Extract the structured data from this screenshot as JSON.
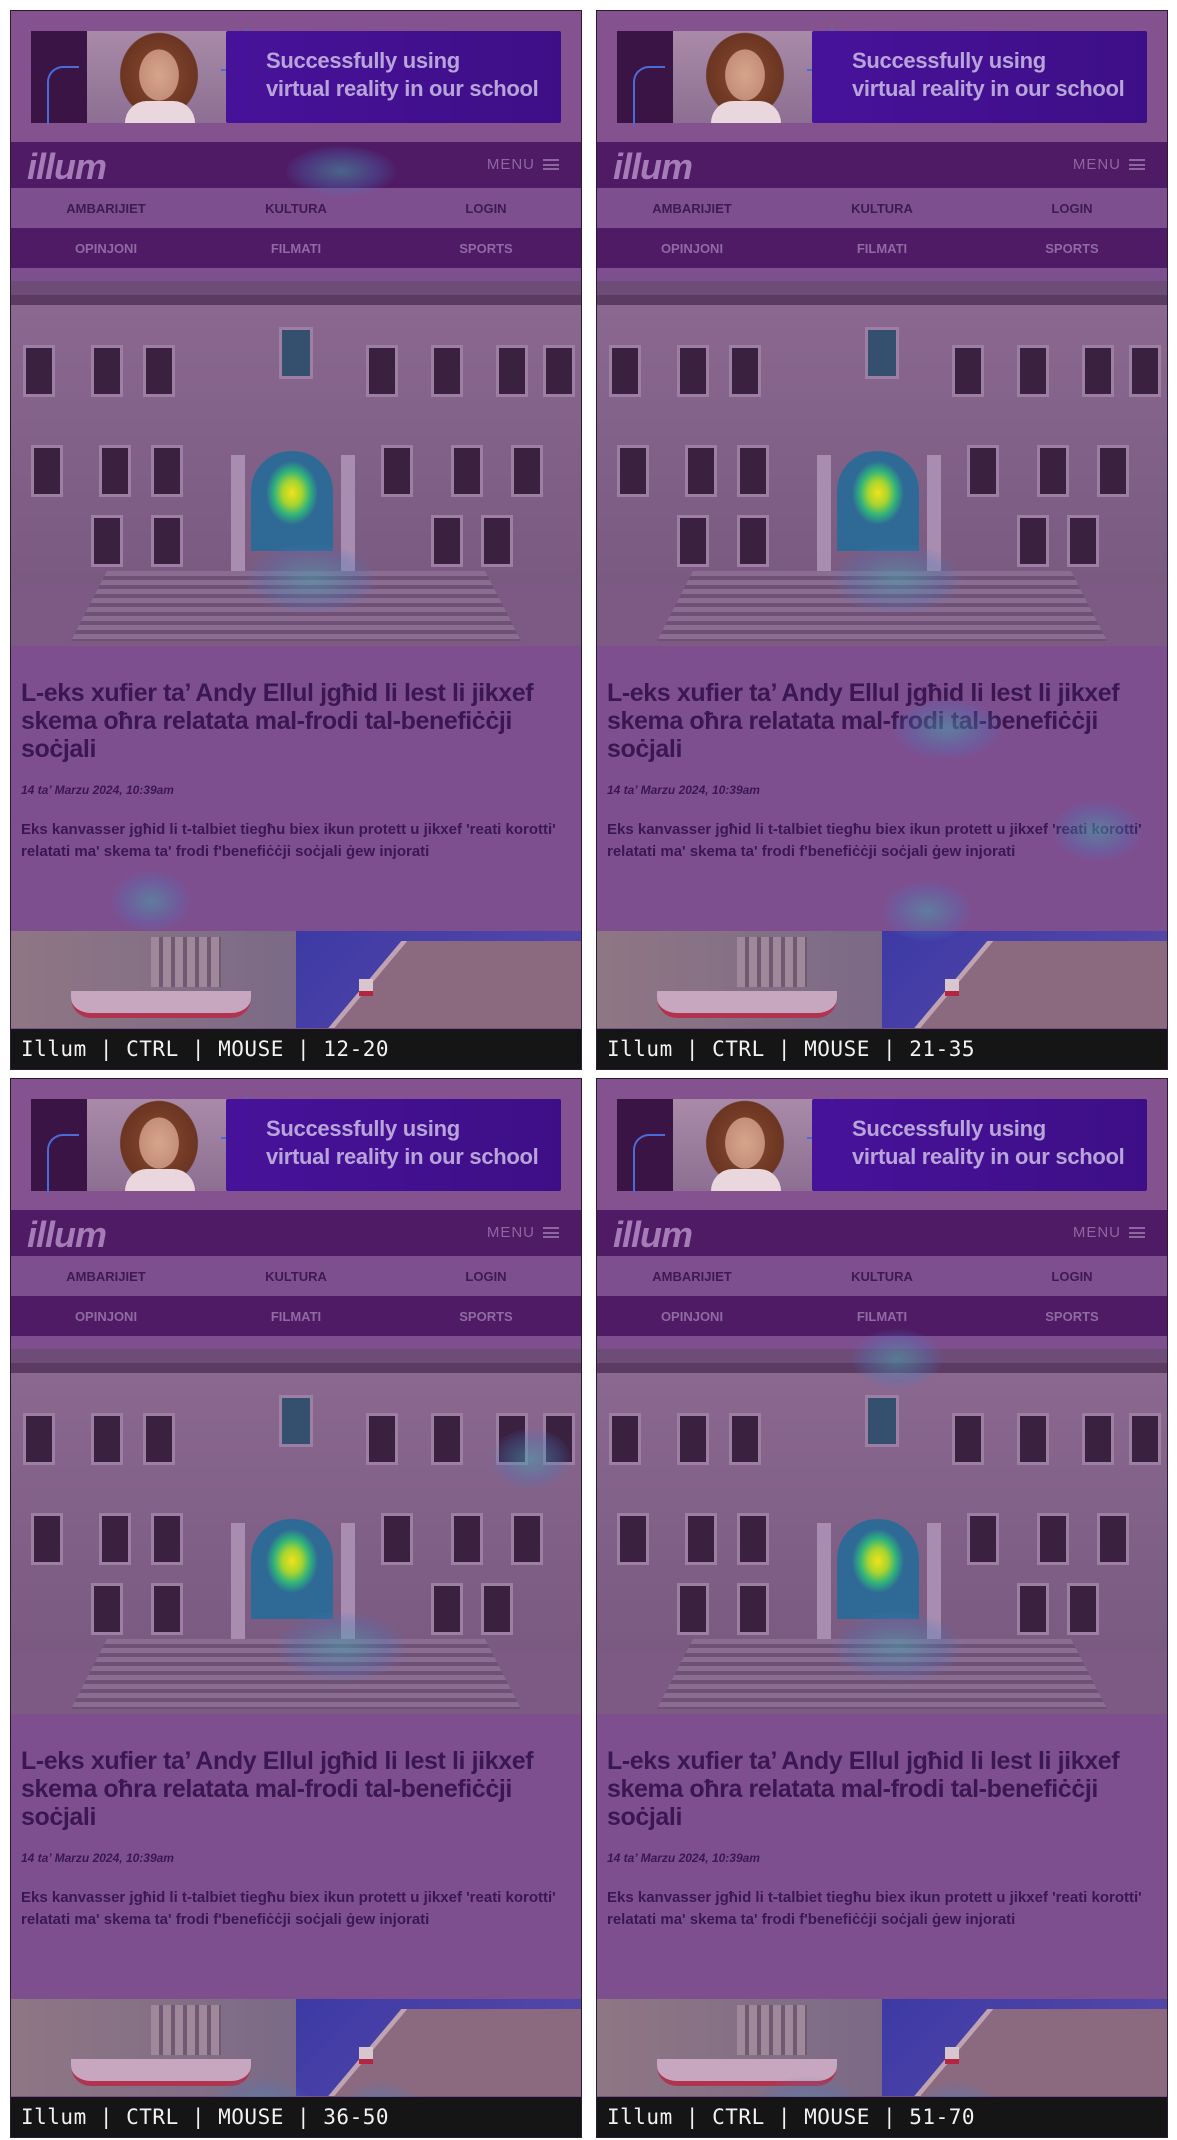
{
  "ad": {
    "headline_line1": "Successfully using",
    "headline_line2": "virtual reality in our school"
  },
  "site": {
    "logo": "illum",
    "menu_label": "MENU",
    "nav_primary": [
      "AMBARIJIET",
      "KULTURA",
      "LOGIN"
    ],
    "nav_secondary": [
      "OPINJONI",
      "FILMATI",
      "SPORTS"
    ]
  },
  "article": {
    "headline": "L-eks xufier ta’ Andy Ellul jgħid li lest li jikxef skema oħra relatata mal-frodi tal-benefiċċji soċjali",
    "date": "14 ta’ Marzu 2024, 10:39am",
    "summary": "Eks kanvasser jgħid li t-talbiet tiegħu biex ikun protett u jikxef 'reati korotti' relatati ma' skema ta' frodi f'benefiċċji soċjali ġew injorati"
  },
  "panels": [
    {
      "caption": "Illum | CTRL | MOUSE | 12-20"
    },
    {
      "caption": "Illum | CTRL | MOUSE | 21-35"
    },
    {
      "caption": "Illum | CTRL | MOUSE | 36-50"
    },
    {
      "caption": "Illum | CTRL | MOUSE | 51-70"
    }
  ],
  "colors": {
    "overlay_purple": "#7e4f8f",
    "nav_dark": "#4e1b64",
    "ad_blue": "#47129a",
    "heat_core": "#f3e11b",
    "heat_mid": "#2fb27c",
    "caption_bar": "#151515"
  }
}
